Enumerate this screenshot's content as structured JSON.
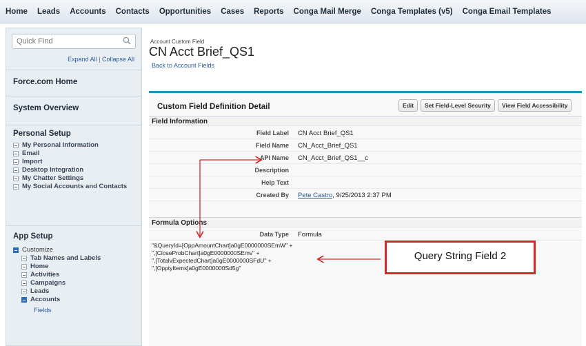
{
  "tabs": [
    "Home",
    "Leads",
    "Accounts",
    "Contacts",
    "Opportunities",
    "Cases",
    "Reports",
    "Conga Mail Merge",
    "Conga Templates (v5)",
    "Conga Email Templates"
  ],
  "sidebar": {
    "quick_find_placeholder": "Quick Find",
    "expand_all": "Expand All",
    "separator": "|",
    "collapse_all": "Collapse All",
    "force_home": "Force.com Home",
    "system_overview": "System Overview",
    "personal_setup": {
      "title": "Personal Setup",
      "items": [
        "My Personal Information",
        "Email",
        "Import",
        "Desktop Integration",
        "My Chatter Settings",
        "My Social Accounts and Contacts"
      ]
    },
    "app_setup": {
      "title": "App Setup",
      "customize": "Customize",
      "items": [
        "Tab Names and Labels",
        "Home",
        "Activities",
        "Campaigns",
        "Leads",
        "Accounts"
      ],
      "fields": "Fields"
    }
  },
  "main": {
    "object_label": "Account Custom Field",
    "title": "CN Acct Brief_QS1",
    "back_link": "Back to Account Fields",
    "panel_title": "Custom Field Definition Detail",
    "buttons": {
      "edit": "Edit",
      "fls": "Set Field-Level Security",
      "accessibility": "View Field Accessibility"
    },
    "field_info": {
      "header": "Field Information",
      "rows": [
        {
          "label": "Field Label",
          "value": "CN Acct Brief_QS1"
        },
        {
          "label": "Field Name",
          "value": "CN_Acct_Brief_QS1"
        },
        {
          "label": "API Name",
          "value": "CN_Acct_Brief_QS1__c"
        },
        {
          "label": "Description",
          "value": ""
        },
        {
          "label": "Help Text",
          "value": ""
        },
        {
          "label": "Created By",
          "value": "Pete Castro",
          "suffix": ", 9/25/2013 2:37 PM"
        }
      ]
    },
    "formula_options": {
      "header": "Formula Options",
      "data_type_label": "Data Type",
      "data_type_value": "Formula",
      "lines": [
        "\"&QueryId=[OppAmountChart]a0gE0000000SEmW\" +",
        "\",[CloseProbChart]a0gE0000000SEmv\" +",
        "\",[TotalvExpectedChart]a0gE0000000SFdU\" +",
        "\",[OpptyItems]a0gE0000000Sd5g\""
      ]
    },
    "callout": "Query String Field 2"
  },
  "colors": {
    "accent": "#1797c0",
    "link": "#2b5c9c",
    "annotation": "#d12a2a"
  }
}
